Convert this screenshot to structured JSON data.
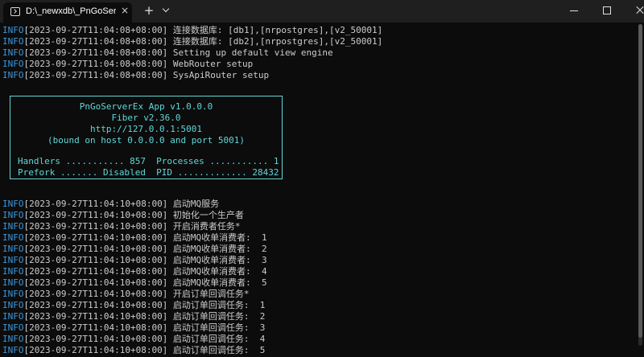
{
  "tab": {
    "title": "D:\\_newxdb\\_PnGoServerEx",
    "close": "×",
    "new_tab": "+"
  },
  "logs_top": [
    {
      "level": "INFO",
      "text": "[2023-09-27T11:04:08+08:00] 连接数据库: [db1],[nrpostgres],[v2_50001]"
    },
    {
      "level": "INFO",
      "text": "[2023-09-27T11:04:08+08:00] 连接数据库: [db2],[nrpostgres],[v2_50001]"
    },
    {
      "level": "INFO",
      "text": "[2023-09-27T11:04:08+08:00] Setting up default view engine"
    },
    {
      "level": "INFO",
      "text": "[2023-09-27T11:04:08+08:00] WebRouter setup"
    },
    {
      "level": "INFO",
      "text": "[2023-09-27T11:04:08+08:00] SysApiRouter setup"
    }
  ],
  "banner": {
    "title": "PnGoServerEx App v1.0.0.0",
    "fiber": "Fiber v2.36.0",
    "url": "http://127.0.0.1:5001",
    "bound": "(bound on host 0.0.0.0 and port 5001)",
    "stats1": "Handlers ........... 857  Processes ........... 1",
    "stats2": "Prefork ....... Disabled  PID ............. 28432"
  },
  "logs_bottom": [
    {
      "level": "INFO",
      "text": "[2023-09-27T11:04:10+08:00] 启动MQ服务"
    },
    {
      "level": "INFO",
      "text": "[2023-09-27T11:04:10+08:00] 初始化一个生产者"
    },
    {
      "level": "INFO",
      "text": "[2023-09-27T11:04:10+08:00] 开启消费者任务*"
    },
    {
      "level": "INFO",
      "text": "[2023-09-27T11:04:10+08:00] 启动MQ收单消费者:  1"
    },
    {
      "level": "INFO",
      "text": "[2023-09-27T11:04:10+08:00] 启动MQ收单消费者:  2"
    },
    {
      "level": "INFO",
      "text": "[2023-09-27T11:04:10+08:00] 启动MQ收单消费者:  3"
    },
    {
      "level": "INFO",
      "text": "[2023-09-27T11:04:10+08:00] 启动MQ收单消费者:  4"
    },
    {
      "level": "INFO",
      "text": "[2023-09-27T11:04:10+08:00] 启动MQ收单消费者:  5"
    },
    {
      "level": "INFO",
      "text": "[2023-09-27T11:04:10+08:00] 开启订单回调任务*"
    },
    {
      "level": "INFO",
      "text": "[2023-09-27T11:04:10+08:00] 启动订单回调任务:  1"
    },
    {
      "level": "INFO",
      "text": "[2023-09-27T11:04:10+08:00] 启动订单回调任务:  2"
    },
    {
      "level": "INFO",
      "text": "[2023-09-27T11:04:10+08:00] 启动订单回调任务:  3"
    },
    {
      "level": "INFO",
      "text": "[2023-09-27T11:04:10+08:00] 启动订单回调任务:  4"
    },
    {
      "level": "INFO",
      "text": "[2023-09-27T11:04:10+08:00] 启动订单回调任务:  5"
    }
  ],
  "colors": {
    "info_level": "#3a96dd",
    "banner": "#61d6d6",
    "text": "#cccccc",
    "background": "#0c0c0c"
  }
}
